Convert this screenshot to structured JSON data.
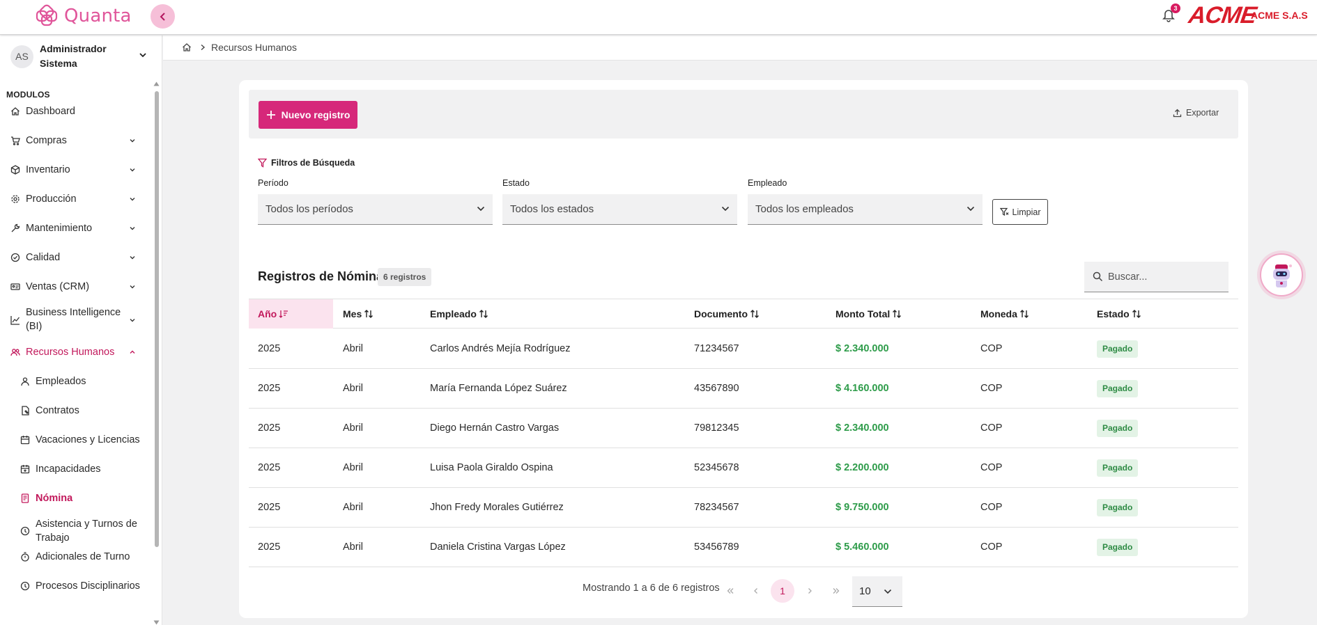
{
  "app": {
    "name": "Quanta",
    "brand_color": "#d6287a"
  },
  "header": {
    "notification_count": "3",
    "company_logo": "ACME",
    "company_name": "ACME S.A.S"
  },
  "user": {
    "initials": "AS",
    "name": "Administrador Sistema"
  },
  "sidebar": {
    "section_title": "MODULOS",
    "items": [
      {
        "label": "Dashboard",
        "icon": "home-icon"
      },
      {
        "label": "Compras",
        "icon": "cart-icon"
      },
      {
        "label": "Inventario",
        "icon": "box-icon"
      },
      {
        "label": "Producción",
        "icon": "gear-icon"
      },
      {
        "label": "Mantenimiento",
        "icon": "wrench-icon"
      },
      {
        "label": "Calidad",
        "icon": "check-circle-icon"
      },
      {
        "label": "Ventas (CRM)",
        "icon": "id-card-icon"
      },
      {
        "label": "Business Intelligence (BI)",
        "icon": "chart-line-icon"
      },
      {
        "label": "Recursos Humanos",
        "icon": "users-icon"
      },
      {
        "label": "Empleados",
        "icon": "user-icon"
      },
      {
        "label": "Contratos",
        "icon": "contract-icon"
      },
      {
        "label": "Vacaciones y Licencias",
        "icon": "calendar-icon"
      },
      {
        "label": "Incapacidades",
        "icon": "calendar-plus-icon"
      },
      {
        "label": "Nómina",
        "icon": "receipt-icon"
      },
      {
        "label": "Asistencia y Turnos de Trabajo",
        "icon": "clock-icon"
      },
      {
        "label": "Adicionales de Turno",
        "icon": "timer-icon"
      },
      {
        "label": "Procesos Disciplinarios",
        "icon": "clock-icon"
      }
    ]
  },
  "breadcrumb": {
    "current": "Recursos Humanos"
  },
  "toolbar": {
    "new_label": "Nuevo registro",
    "export_label": "Exportar"
  },
  "filters": {
    "title": "Filtros de Búsqueda",
    "periodo": {
      "label": "Período",
      "value": "Todos los períodos"
    },
    "estado": {
      "label": "Estado",
      "value": "Todos los estados"
    },
    "empleado": {
      "label": "Empleado",
      "value": "Todos los empleados"
    },
    "clear_label": "Limpiar"
  },
  "table": {
    "title": "Registros de Nómina",
    "count_badge": "6 registros",
    "search_placeholder": "Buscar...",
    "columns": [
      "Año",
      "Mes",
      "Empleado",
      "Documento",
      "Monto Total",
      "Moneda",
      "Estado"
    ],
    "rows": [
      [
        "2025",
        "Abril",
        "Carlos Andrés Mejía Rodríguez",
        "71234567",
        "$ 2.340.000",
        "COP",
        "Pagado"
      ],
      [
        "2025",
        "Abril",
        "María Fernanda López Suárez",
        "43567890",
        "$ 4.160.000",
        "COP",
        "Pagado"
      ],
      [
        "2025",
        "Abril",
        "Diego Hernán Castro Vargas",
        "79812345",
        "$ 2.340.000",
        "COP",
        "Pagado"
      ],
      [
        "2025",
        "Abril",
        "Luisa Paola Giraldo Ospina",
        "52345678",
        "$ 2.200.000",
        "COP",
        "Pagado"
      ],
      [
        "2025",
        "Abril",
        "Jhon Fredy Morales Gutiérrez",
        "78234567",
        "$ 9.750.000",
        "COP",
        "Pagado"
      ],
      [
        "2025",
        "Abril",
        "Daniela Cristina Vargas López",
        "53456789",
        "$ 5.460.000",
        "COP",
        "Pagado"
      ]
    ]
  },
  "pagination": {
    "showing": "Mostrando 1 a 6 de 6 registros",
    "current_page": "1",
    "page_size": "10"
  }
}
